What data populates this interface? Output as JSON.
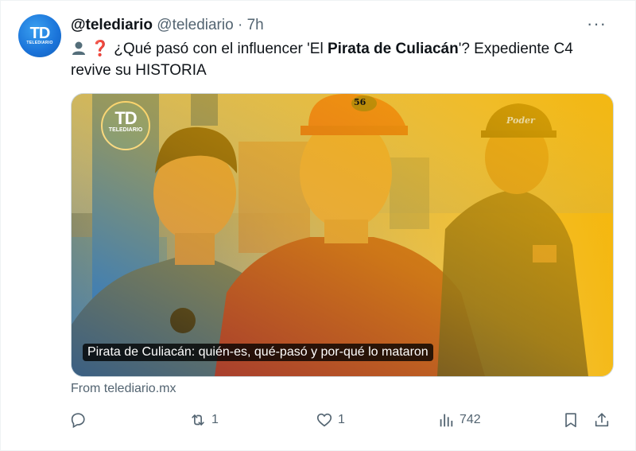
{
  "tweet": {
    "author_name": "@telediario",
    "author_handle": "@telediario",
    "separator": "·",
    "time": "7h",
    "avatar_text": "TD",
    "avatar_subtext": "TELEDIARIO",
    "more_label": "···",
    "text_pre": "¿Qué pasó con el influencer 'El ",
    "text_bold": "Pirata de Culiacán",
    "text_post": "'? Expediente C4 revive su HISTORIA",
    "question_mark": "❓"
  },
  "card": {
    "logo_text": "TD",
    "logo_subtext": "TELEDIARIO",
    "caption": "Pirata de Culiacán: quién-es, qué-pasó y por-qué lo mataron",
    "cap_left_text": "56",
    "cap_right_text": "Poder",
    "source": "From telediario.mx"
  },
  "actions": {
    "reply_count": "",
    "retweet_count": "1",
    "like_count": "1",
    "views_count": "742"
  },
  "colors": {
    "accent_blue": "#1d9bf0",
    "muted_gray": "#536471",
    "telediario_blue": "#1a73d9"
  }
}
